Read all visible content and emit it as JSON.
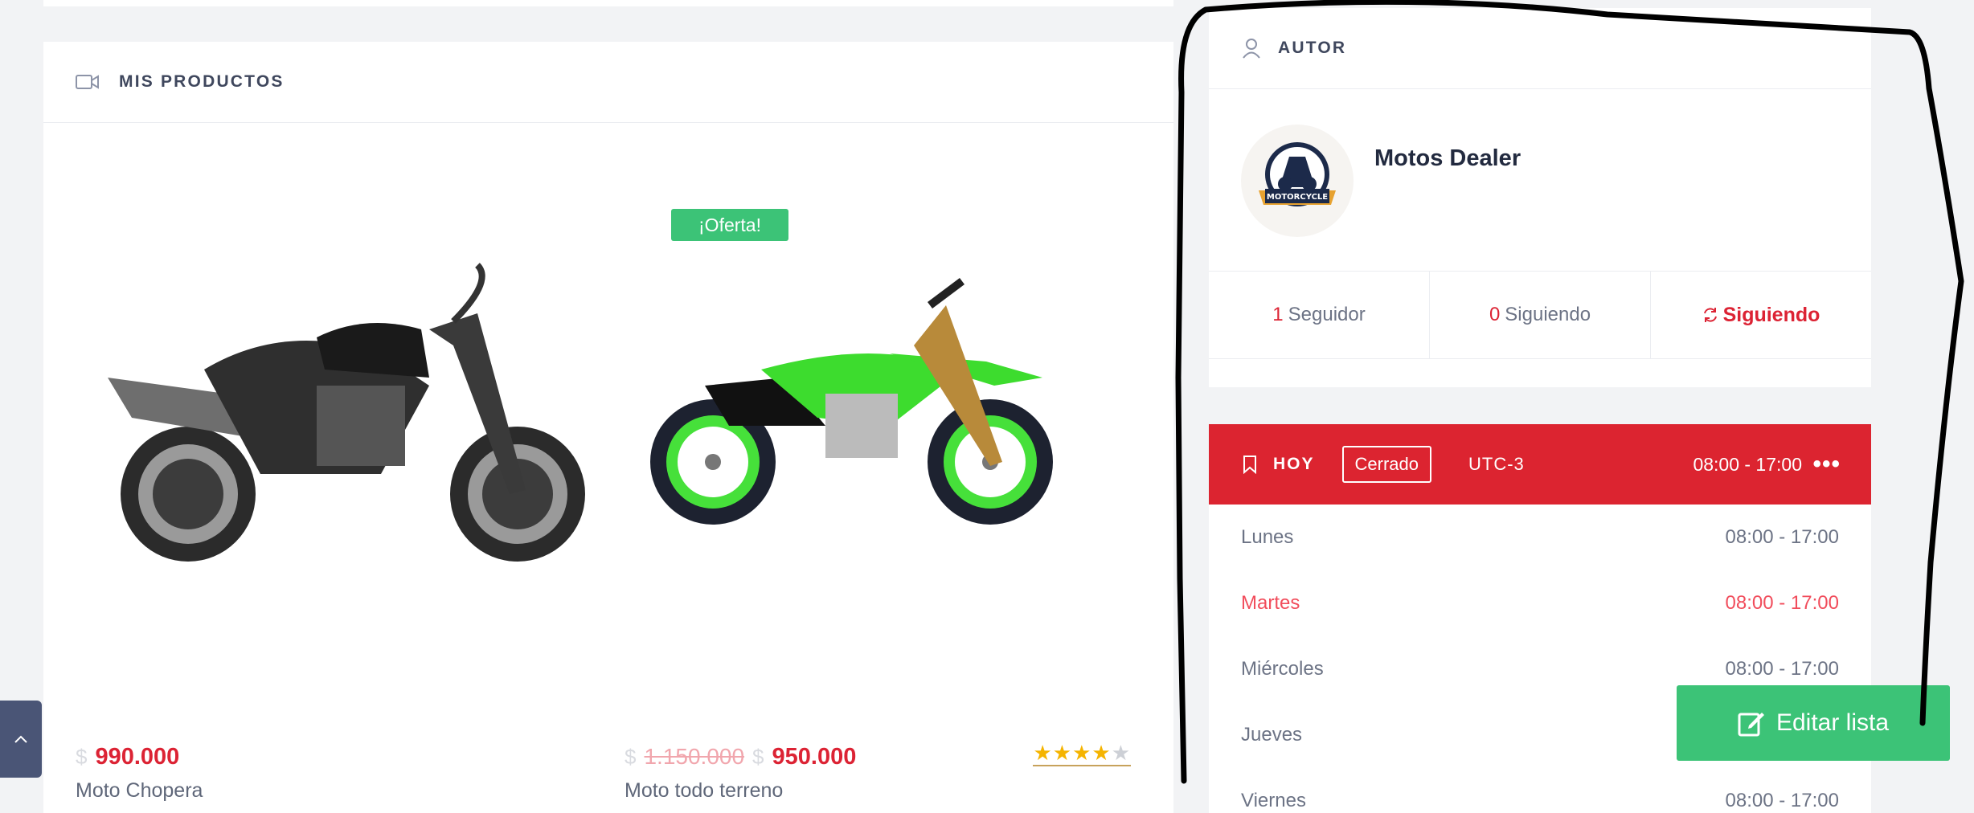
{
  "products_section": {
    "title": "MIS PRODUCTOS",
    "items": [
      {
        "name": "Moto Chopera",
        "currency": "$",
        "price": "990.000"
      },
      {
        "name": "Moto todo terreno",
        "currency": "$",
        "old_price": "1.150.000",
        "price": "950.000",
        "badge": "¡Oferta!",
        "rating": 4,
        "rating_max": 5
      }
    ]
  },
  "author": {
    "title": "AUTOR",
    "name": "Motos Dealer",
    "logo_text": "MOTORCYCLE",
    "followers_count": "1",
    "followers_label": "Seguidor",
    "following_count": "0",
    "following_label": "Siguiendo",
    "follow_button": "Siguiendo"
  },
  "hours": {
    "title": "HOY",
    "status": "Cerrado",
    "timezone": "UTC-3",
    "today_hours": "08:00 - 17:00",
    "more": "•••",
    "days": [
      {
        "day": "Lunes",
        "time": "08:00 - 17:00"
      },
      {
        "day": "Martes",
        "time": "08:00 - 17:00",
        "active": true
      },
      {
        "day": "Miércoles",
        "time": "08:00 - 17:00"
      },
      {
        "day": "Jueves",
        "time": ""
      },
      {
        "day": "Viernes",
        "time": "08:00 - 17:00"
      }
    ]
  },
  "edit_button": "Editar lista",
  "colors": {
    "accent": "#dc2334",
    "green": "#3cc377",
    "dark": "#4a5576"
  }
}
